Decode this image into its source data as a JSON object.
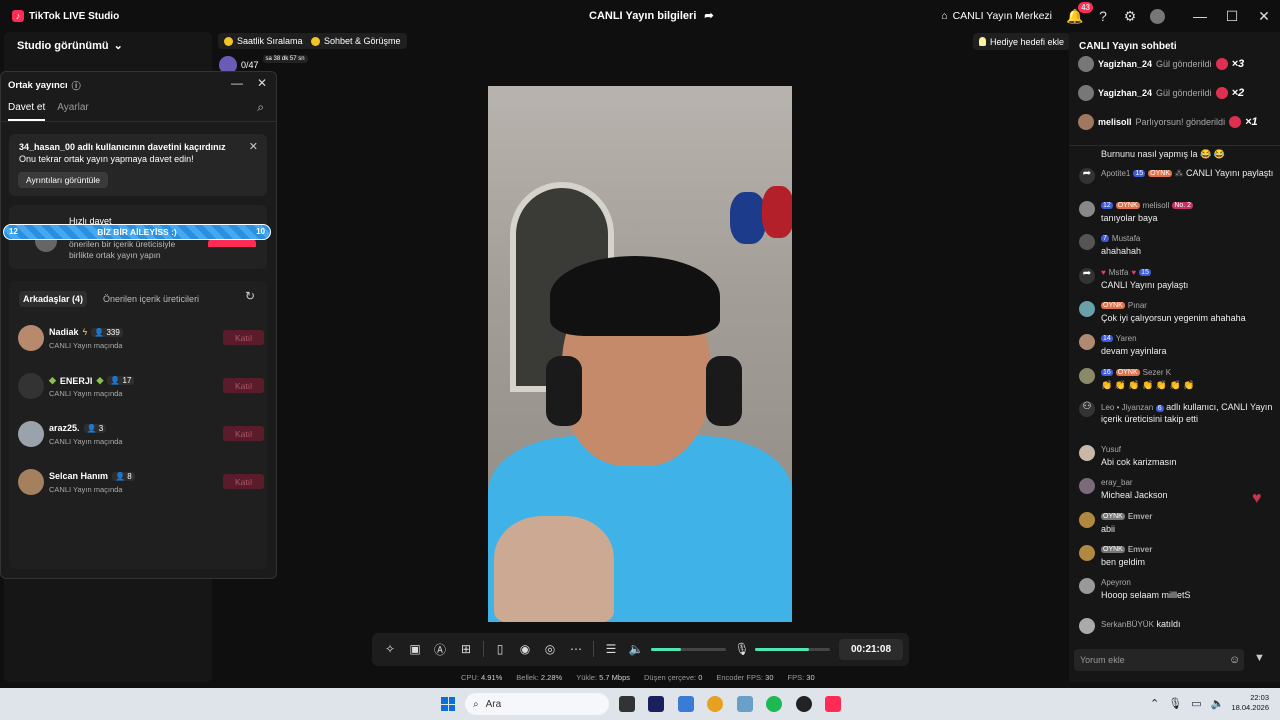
{
  "app": {
    "title": "TikTok LIVE Studio",
    "logo_glyph": "♪"
  },
  "header": {
    "center_title": "CANLI Yayın bilgileri",
    "live_center": "CANLI Yayın Merkezi",
    "notification_count": "43"
  },
  "studio": {
    "view_label": "Studio görünümü"
  },
  "chips": {
    "hourly": "Saatlik Sıralama",
    "chat_meet": "Sohbet & Görüşme",
    "gift_goal": "Hediye hedefi ekle"
  },
  "counter": {
    "value": "0/47",
    "timer": "sa 38 dk 57 sn"
  },
  "cohost": {
    "title": "Ortak yayıncı",
    "tabs": [
      "Davet et",
      "Ayarlar"
    ],
    "notice_line1": "34_hasan_00 adlı kullanıcının davetini kaçırdınız",
    "notice_line2": "Onu tekrar ortak yayın yapmaya davet edin!",
    "notice_button": "Ayrıntıları görüntüle",
    "quick_title": "Hızlı davet",
    "quick_sub1": "önerilen bir içerik üreticisiyle",
    "quick_sub2": "birlikte ortak yayın yapın",
    "banner_text": "BİZ BİR AİLEYİSS :)",
    "banner_left": "12",
    "banner_right": "10",
    "friends_tab": "Arkadaşlar (4)",
    "suggested_tab": "Önerilen içerik üreticileri",
    "join_label": "Katıl",
    "friends": [
      {
        "name": "Nadiak",
        "count": "339",
        "status": "CANLI Yayın maçında"
      },
      {
        "name": "ENERJI",
        "count": "17",
        "status": "CANLI Yayın maçında"
      },
      {
        "name": "araz25.",
        "count": "3",
        "status": "CANLI Yayın maçında"
      },
      {
        "name": "Selcan Hanım",
        "count": "8",
        "status": "CANLI Yayın maçında"
      }
    ]
  },
  "controls": {
    "timer": "00:21:08",
    "volume_level": 0.4,
    "mic_level": 0.72
  },
  "stats": {
    "cpu_label": "CPU:",
    "cpu": "4.91%",
    "mem_label": "Bellek:",
    "mem": "2.28%",
    "upload_label": "Yükle:",
    "upload": "5.7 Mbps",
    "dropped_label": "Düşen çerçeve:",
    "dropped": "0",
    "encoder_label": "Encoder FPS:",
    "encoder": "30",
    "fps_label": "FPS:",
    "fps": "30"
  },
  "chat": {
    "title": "CANLI Yayın sohbeti",
    "gifts": [
      {
        "user": "Yagizhan_24",
        "action": "Gül gönderildi",
        "mult": "×3"
      },
      {
        "user": "Yagizhan_24",
        "action": "Gül gönderildi",
        "mult": "×2"
      },
      {
        "user": "melisoll",
        "action": "Parlıyorsun! gönderildi",
        "mult": "×1"
      }
    ],
    "messages": {
      "m0": {
        "text": "Burnunu nasıl yapmış la 😂 😂"
      },
      "m1": {
        "user": "Apotite1",
        "level": "15",
        "tag": "OYNK",
        "text": "CANLI Yayını paylaştı"
      },
      "m2": {
        "level": "12",
        "tag": "OYNK",
        "user": "melisoll",
        "rank": "No. 2",
        "text": "tanıyolar baya"
      },
      "m3": {
        "level": "7",
        "user": "Mustafa",
        "text": "ahahahah"
      },
      "m4": {
        "user": "Mstfa",
        "level": "15",
        "text": "CANLI Yayını paylaştı"
      },
      "m5": {
        "tag": "OYNK",
        "user": "Pınar",
        "text": "Çok iyi çalıyorsun yegenim ahahaha"
      },
      "m6": {
        "level": "14",
        "user": "Yaren",
        "text": "devam yayinlara"
      },
      "m7": {
        "level": "16",
        "tag": "OYNK",
        "user": "Sezer K",
        "text": "👏 👏 👏 👏 👏 👏 👏"
      },
      "m8": {
        "user": "Leo • Jiyanzan",
        "level": "6",
        "text": "adlı kullanıcı, CANLI Yayın içerik üreticisini takip etti"
      },
      "m9": {
        "user": "Yusuf",
        "text": "Abi cok karizmasın"
      },
      "m10": {
        "user": "eray_bar",
        "text": "Micheal Jackson"
      },
      "m11": {
        "tag": "OYNK",
        "user": "Emver",
        "text": "abii"
      },
      "m12": {
        "tag": "OYNK",
        "user": "Emver",
        "text": "ben geldim"
      },
      "m13": {
        "user": "Apeyron",
        "text": "Hooop selaam millletS"
      },
      "m14": {
        "user": "SerkanBÜYÜK",
        "text": "katıldı"
      }
    },
    "comment_placeholder": "Yorum ekle"
  },
  "taskbar": {
    "search": "Ara",
    "time": "22:03",
    "date": "18.04.2026"
  },
  "colors": {
    "accent": "#fe2c55",
    "slider": "#4de8b2",
    "banner": "#2b8fe0"
  }
}
